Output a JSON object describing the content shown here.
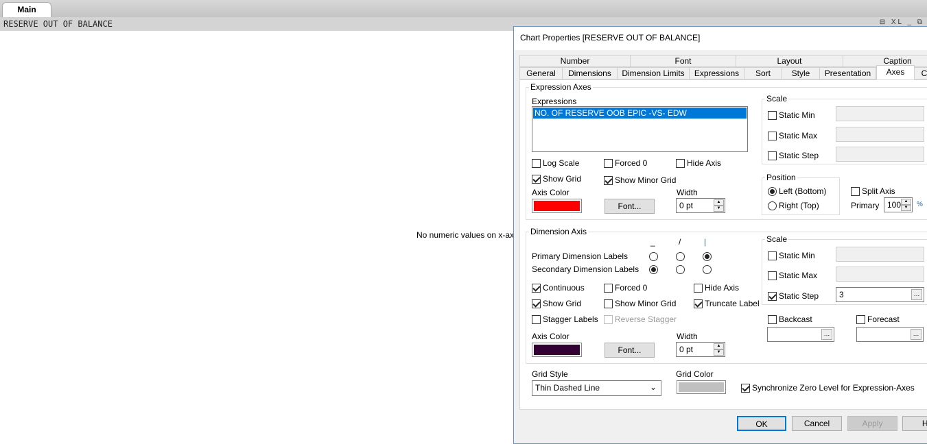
{
  "app": {
    "sheet_tab": "Main",
    "chart_caption": "RESERVE OUT OF BALANCE",
    "caption_icons": "⊟ XL _ ⧉",
    "chart_message": "No numeric values on x-axis"
  },
  "dialog": {
    "title": "Chart Properties [RESERVE OUT OF BALANCE]",
    "tabs_row1": [
      "Number",
      "Font",
      "Layout",
      "Caption"
    ],
    "tabs_row2": [
      "General",
      "Dimensions",
      "Dimension Limits",
      "Expressions",
      "Sort",
      "Style",
      "Presentation",
      "Axes",
      "C"
    ],
    "active_tab": "Axes",
    "expression_axes": {
      "legend": "Expression Axes",
      "expressions_label": "Expressions",
      "expressions": [
        "NO. OF RESERVE OOB EPIC -VS- EDW"
      ],
      "log_scale": {
        "label": "Log Scale",
        "checked": false
      },
      "forced0": {
        "label": "Forced 0",
        "checked": false
      },
      "hide_axis": {
        "label": "Hide Axis",
        "checked": false
      },
      "show_grid": {
        "label": "Show Grid",
        "checked": true
      },
      "show_minor_grid": {
        "label": "Show Minor Grid",
        "checked": true
      },
      "axis_color_label": "Axis Color",
      "axis_color": "#ff0000",
      "font_button": "Font...",
      "width_label": "Width",
      "width": "0 pt",
      "scale": {
        "legend": "Scale",
        "static_min": "Static Min",
        "static_max": "Static Max",
        "static_step": "Static Step"
      },
      "position": {
        "legend": "Position",
        "left": "Left (Bottom)",
        "right": "Right (Top)",
        "selected": "left"
      },
      "split_axis": {
        "label": "Split Axis",
        "checked": false
      },
      "primary_label": "Primary",
      "primary_value": "100",
      "percent": "%"
    },
    "dimension_axis": {
      "legend": "Dimension Axis",
      "orient_headers": [
        "_",
        "/",
        "|"
      ],
      "primary_labels": "Primary Dimension Labels",
      "primary_selected": 2,
      "secondary_labels": "Secondary Dimension Labels",
      "secondary_selected": 0,
      "continuous": {
        "label": "Continuous",
        "checked": true
      },
      "forced0": {
        "label": "Forced 0",
        "checked": false
      },
      "hide_axis": {
        "label": "Hide Axis",
        "checked": false
      },
      "show_grid": {
        "label": "Show Grid",
        "checked": true
      },
      "show_minor_grid": {
        "label": "Show Minor Grid",
        "checked": false
      },
      "truncate_label": {
        "label": "Truncate Label",
        "checked": true
      },
      "stagger_labels": {
        "label": "Stagger Labels",
        "checked": false
      },
      "reverse_stagger": {
        "label": "Reverse Stagger",
        "checked": false
      },
      "axis_color_label": "Axis Color",
      "axis_color": "#330033",
      "font_button": "Font...",
      "width_label": "Width",
      "width": "0 pt",
      "scale": {
        "legend": "Scale",
        "static_min": "Static Min",
        "static_max": "Static Max",
        "static_step": "Static Step",
        "static_step_checked": true,
        "static_step_value": "3"
      },
      "backcast": "Backcast",
      "forecast": "Forecast"
    },
    "grid_style_label": "Grid Style",
    "grid_style": "Thin Dashed Line",
    "grid_color_label": "Grid Color",
    "grid_color": "#c0c0c0",
    "sync_zero": {
      "label": "Synchronize Zero Level for Expression-Axes",
      "checked": true
    },
    "buttons": {
      "ok": "OK",
      "cancel": "Cancel",
      "apply": "Apply",
      "help": "He"
    }
  }
}
